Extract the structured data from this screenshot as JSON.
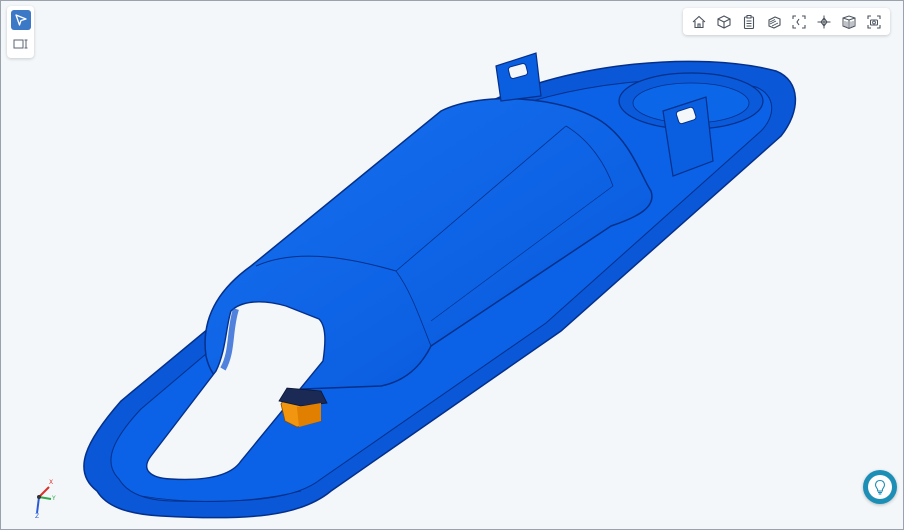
{
  "viewer": {
    "background": "#f4f7fa",
    "model_color": "#0a5fe0",
    "marker_color": "#f2950f"
  },
  "left_panel": {
    "tools": [
      {
        "icon": "cursor-select-icon",
        "active": true
      },
      {
        "icon": "panel-toggle-icon",
        "active": false
      }
    ]
  },
  "toolbar": {
    "buttons": [
      {
        "icon": "home-icon"
      },
      {
        "icon": "cube-view-icon"
      },
      {
        "icon": "clipboard-icon"
      },
      {
        "icon": "layers-icon"
      },
      {
        "icon": "fit-view-icon"
      },
      {
        "icon": "explode-icon"
      },
      {
        "icon": "cube-grid-icon"
      },
      {
        "icon": "screenshot-icon"
      }
    ]
  },
  "axis_triad": {
    "x_label": "X",
    "y_label": "Y",
    "z_label": "Z"
  },
  "hint_button": {
    "icon": "lightbulb-icon"
  }
}
